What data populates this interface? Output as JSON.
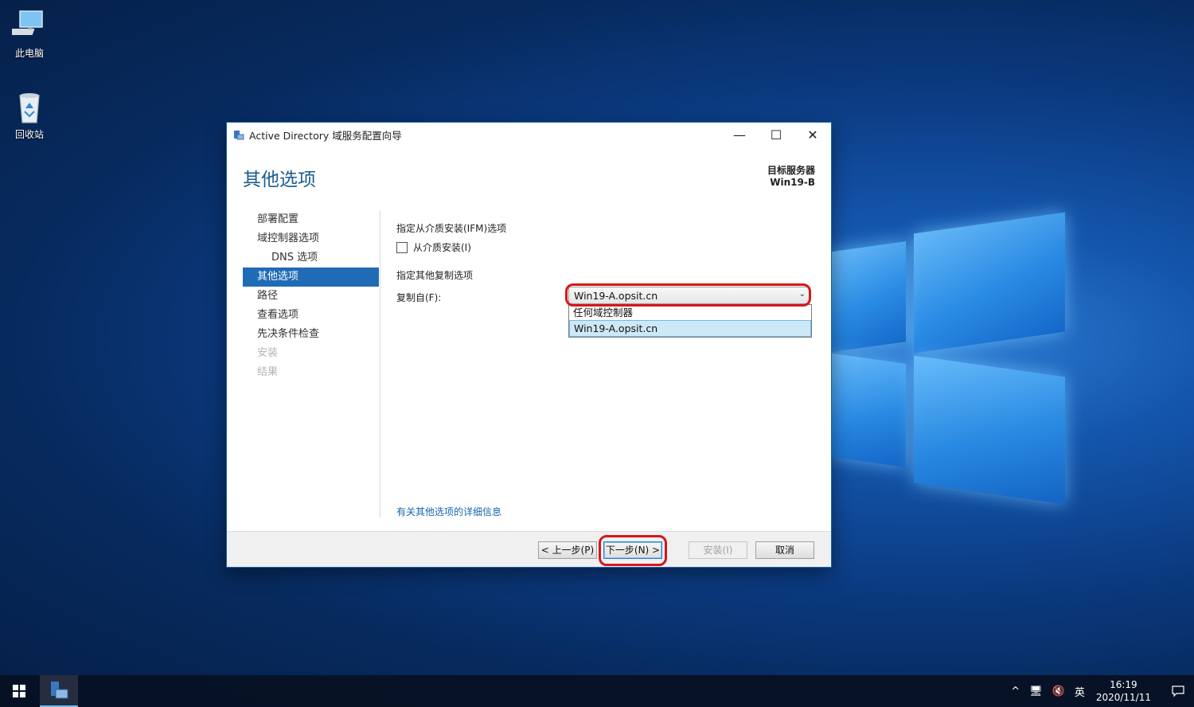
{
  "desktop": {
    "icons": [
      {
        "label": "此电脑"
      },
      {
        "label": "回收站"
      }
    ]
  },
  "window": {
    "title": "Active Directory 域服务配置向导",
    "controls": {
      "minimize": "—",
      "maximize": "☐",
      "close": "✕"
    },
    "page_title": "其他选项",
    "target_server_label": "目标服务器",
    "target_server_name": "Win19-B",
    "nav": [
      {
        "label": "部署配置",
        "state": "normal"
      },
      {
        "label": "域控制器选项",
        "state": "normal"
      },
      {
        "label": "DNS 选项",
        "state": "normal"
      },
      {
        "label": "其他选项",
        "state": "active"
      },
      {
        "label": "路径",
        "state": "normal"
      },
      {
        "label": "查看选项",
        "state": "normal"
      },
      {
        "label": "先决条件检查",
        "state": "normal"
      },
      {
        "label": "安装",
        "state": "disabled"
      },
      {
        "label": "结果",
        "state": "disabled"
      }
    ],
    "content": {
      "ifm_section": "指定从介质安装(IFM)选项",
      "ifm_checkbox_label": "从介质安装(I)",
      "ifm_checked": false,
      "replication_section": "指定其他复制选项",
      "replicate_from_label": "复制自(F):",
      "replicate_from_value": "Win19-A.opsit.cn",
      "dropdown_options": [
        "任何域控制器",
        "Win19-A.opsit.cn"
      ],
      "dropdown_selected_index": 1,
      "more_info_link": "有关其他选项的详细信息"
    },
    "buttons": {
      "back": "< 上一步(P)",
      "next": "下一步(N) >",
      "install": "安装(I)",
      "cancel": "取消"
    }
  },
  "taskbar": {
    "ime": "英",
    "time": "16:19",
    "date": "2020/11/11"
  },
  "colors": {
    "accent": "#1f6bb5",
    "title_blue": "#1c5c8e",
    "highlight_ring": "#d4181c"
  }
}
